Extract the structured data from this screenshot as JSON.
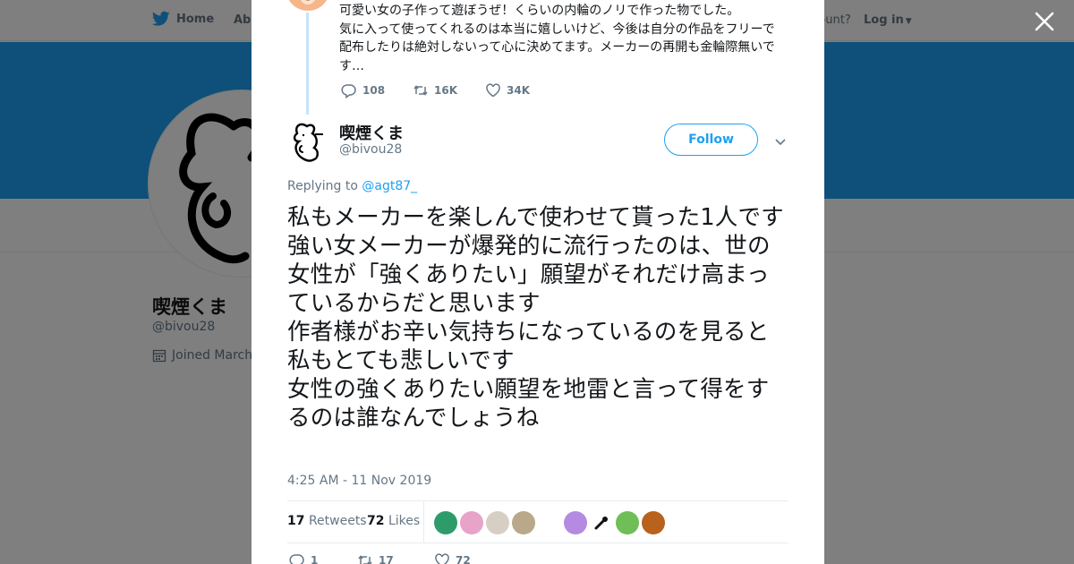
{
  "topnav": {
    "home_label": "Home",
    "about_label": "Abo",
    "account_text": "ccount?",
    "login_label": "Log in"
  },
  "profile": {
    "name": "喫煙くま",
    "handle": "@bivou28",
    "joined": "Joined March"
  },
  "parent_tweet": {
    "lines": [
      "可愛い女の子作って遊ぼうぜ！くらいの内輪のノリで作った物でした。",
      "気に入って使ってくれるのは本当に嬉しいけど、今後は自分の作品をフリーで配布したりは絶対しないって心に決めてます。メーカーの再開も金輪際無いです…"
    ],
    "replies": "108",
    "retweets": "16K",
    "likes": "34K"
  },
  "tweet": {
    "author_name": "喫煙くま",
    "author_handle": "@bivou28",
    "follow_label": "Follow",
    "replying_prefix": "Replying to",
    "replying_to": "@agt87_",
    "text": "私もメーカーを楽しんで使わせて貰った1人です\n強い女メーカーが爆発的に流行ったのは、世の女性が「強くありたい」願望がそれだけ高まっているからだと思います\n作者様がお辛い気持ちになっているのを見ると私もとても悲しいです\n女性の強くありたい願望を地雷と言って得をするのは誰なんでしょうね",
    "timestamp": "4:25 AM - 11 Nov 2019",
    "retweet_count": "17",
    "retweet_label": "Retweets",
    "like_count": "72",
    "like_label": "Likes",
    "reply_count": "1",
    "retweet_count_bottom": "17",
    "like_count_bottom": "72"
  },
  "likers": [
    {
      "name": "liker-1",
      "color": "#2e9c6a"
    },
    {
      "name": "liker-2",
      "color": "#e7a3c8"
    },
    {
      "name": "liker-3",
      "color": "#d8cfc4"
    },
    {
      "name": "liker-4",
      "color": "#b9a98a"
    },
    {
      "name": "liker-5",
      "color": "#b48be0"
    },
    {
      "name": "liker-6",
      "color": "#ffffff"
    },
    {
      "name": "liker-7",
      "color": "#6fbe58"
    },
    {
      "name": "liker-8",
      "color": "#b8621e"
    }
  ],
  "colors": {
    "accent": "#1da1f2",
    "thread_line": "#c4e4fa",
    "muted_text": "#657786",
    "banner": "#1da1f2"
  }
}
